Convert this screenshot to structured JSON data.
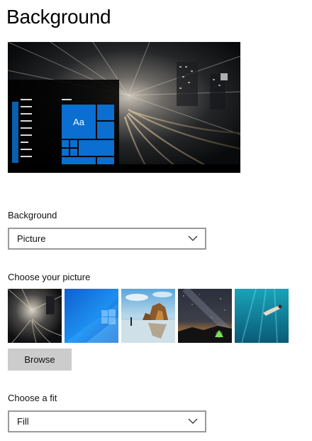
{
  "page": {
    "title": "Background"
  },
  "preview": {
    "tile_text": "Aa"
  },
  "background_setting": {
    "label": "Background",
    "value": "Picture"
  },
  "choose_picture": {
    "label": "Choose your picture",
    "thumbnails": [
      {
        "name": "city-motion-blur"
      },
      {
        "name": "windows-blue-light"
      },
      {
        "name": "beach-rocks"
      },
      {
        "name": "night-sky-tent"
      },
      {
        "name": "underwater-swimmer"
      }
    ]
  },
  "browse": {
    "label": "Browse"
  },
  "fit": {
    "label": "Choose a fit",
    "value": "Fill"
  },
  "colors": {
    "accent": "#0a6fd0",
    "button_bg": "#cccccc",
    "select_border": "#9a9a9a"
  }
}
